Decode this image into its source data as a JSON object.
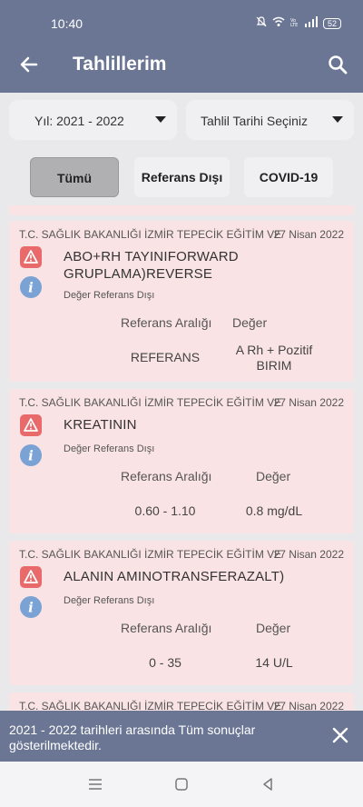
{
  "status": {
    "time": "10:40",
    "battery": "52"
  },
  "header": {
    "title": "Tahlillerim"
  },
  "filters": {
    "year": "Yıl: 2021 - 2022",
    "date": "Tahlil Tarihi Seçiniz"
  },
  "tabs": [
    {
      "label": "Tümü"
    },
    {
      "label": "Referans Dışı"
    },
    {
      "label": "COVID-19"
    }
  ],
  "results": [
    {
      "hospital": "T.C. SAĞLIK BAKANLIĞI İZMİR TEPECİK EĞİTİM VE",
      "date": "27 Nisan 2022",
      "name": "ABO+RH TAYINIFORWARD GRUPLAMA)REVERSE",
      "status": "Değer Referans Dışı",
      "ref_header": "Referans Aralığı",
      "val_header": "Değer",
      "ref": "REFERANS",
      "value": "A Rh + Pozitif BIRIM"
    },
    {
      "hospital": "T.C. SAĞLIK BAKANLIĞI İZMİR TEPECİK EĞİTİM VE",
      "date": "27 Nisan 2022",
      "name": "KREATININ",
      "status": "Değer Referans Dışı",
      "ref_header": "Referans Aralığı",
      "val_header": "Değer",
      "ref": "0.60 - 1.10",
      "value": "0.8 mg/dL"
    },
    {
      "hospital": "T.C. SAĞLIK BAKANLIĞI İZMİR TEPECİK EĞİTİM VE",
      "date": "27 Nisan 2022",
      "name": "ALANIN AMINOTRANSFERAZALT)",
      "status": "Değer Referans Dışı",
      "ref_header": "Referans Aralığı",
      "val_header": "Değer",
      "ref": "0 - 35",
      "value": "14 U/L"
    },
    {
      "hospital": "T.C. SAĞLIK BAKANLIĞI İZMİR TEPECİK EĞİTİM VE",
      "date": "27 Nisan 2022"
    }
  ],
  "snackbar": {
    "message": "2021 - 2022 tarihleri arasında Tüm sonuçlar gösterilmektedir."
  },
  "colors": {
    "primary": "#6b7694",
    "card": "#fae3e4",
    "warning": "#e86a6a",
    "info": "#7aa2d4"
  }
}
